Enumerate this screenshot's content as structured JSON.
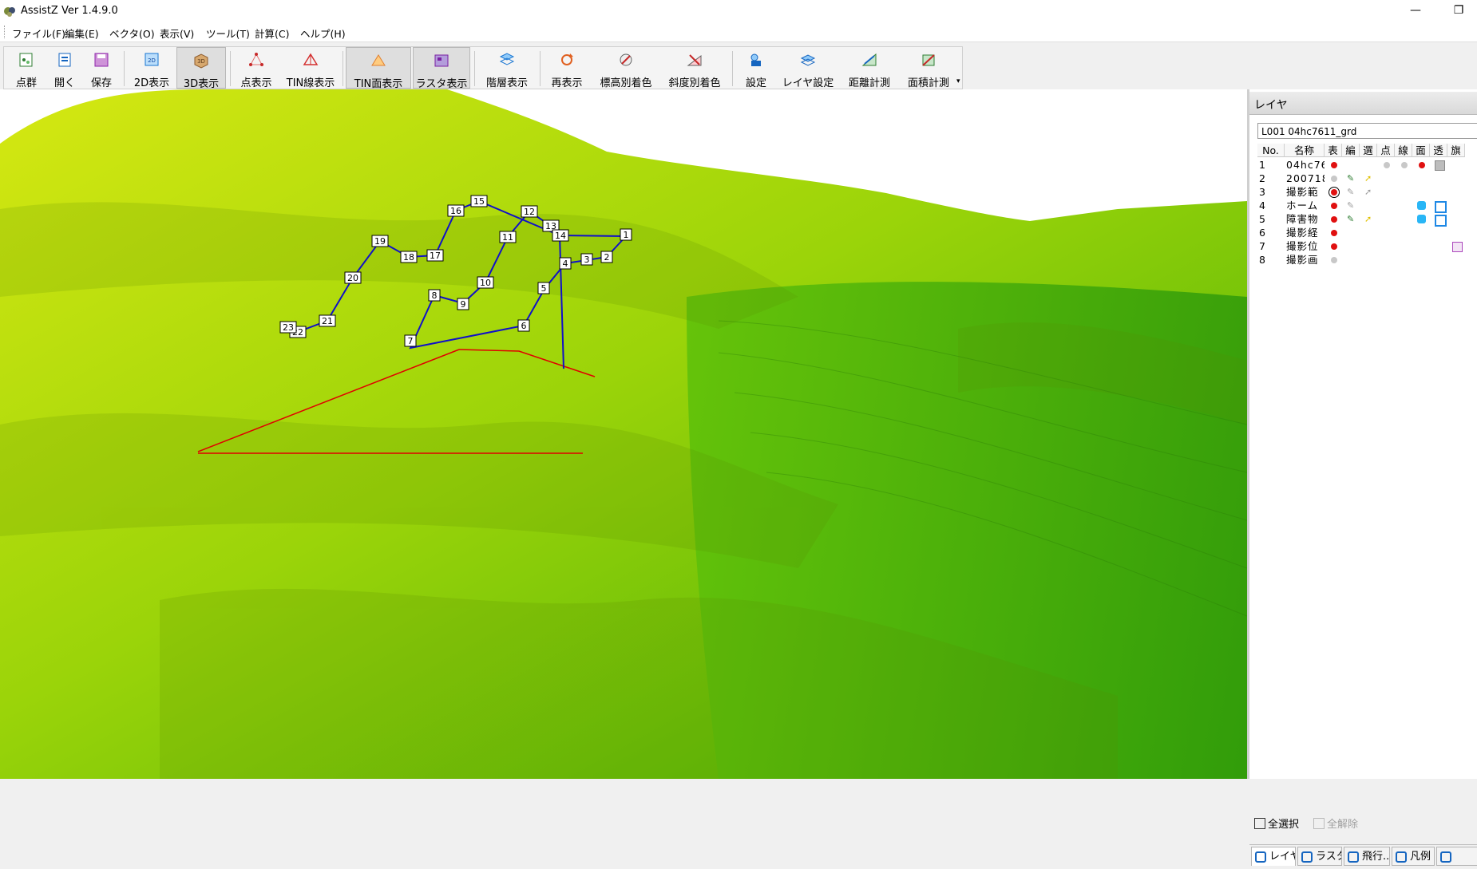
{
  "window": {
    "title": "AssistZ  Ver 1.4.9.0",
    "minimize": "—",
    "restore": "❐"
  },
  "menu": [
    "ファイル(F)",
    "編集(E)",
    "ベクタ(O)",
    "表示(V)",
    "ツール(T)",
    "計算(C)",
    "ヘルプ(H)"
  ],
  "toolbar": [
    {
      "label": "点群",
      "icon": "point-cloud-icon",
      "color": "#2e7d32",
      "active": false
    },
    {
      "label": "開く",
      "icon": "open-icon",
      "color": "#1565c0",
      "active": false
    },
    {
      "label": "保存",
      "icon": "save-icon",
      "color": "#8e24aa",
      "active": false
    },
    {
      "label": "2D表示",
      "icon": "2d-view-icon",
      "color": "#1976d2",
      "active": false
    },
    {
      "label": "3D表示",
      "icon": "3d-view-icon",
      "color": "#c08040",
      "active": true
    },
    {
      "label": "点表示",
      "icon": "point-display-icon",
      "color": "#c62828",
      "active": false
    },
    {
      "label": "TIN線表示",
      "icon": "tin-line-icon",
      "color": "#d32f2f",
      "active": false
    },
    {
      "label": "TIN面表示",
      "icon": "tin-surface-icon",
      "color": "#e08030",
      "active": true
    },
    {
      "label": "ラスタ表示",
      "icon": "raster-display-icon",
      "color": "#7b1fa2",
      "active": true
    },
    {
      "label": "階層表示",
      "icon": "hierarchy-icon",
      "color": "#1976d2",
      "active": false
    },
    {
      "label": "再表示",
      "icon": "refresh-icon",
      "color": "#e06020",
      "active": false
    },
    {
      "label": "標高別着色",
      "icon": "elevation-color-icon",
      "color": "#c62828",
      "active": false
    },
    {
      "label": "斜度別着色",
      "icon": "slope-color-icon",
      "color": "#c62828",
      "active": false
    },
    {
      "label": "設定",
      "icon": "settings-icon",
      "color": "#1565c0",
      "active": false
    },
    {
      "label": "レイヤ設定",
      "icon": "layer-settings-icon",
      "color": "#1565c0",
      "active": false
    },
    {
      "label": "距離計測",
      "icon": "distance-measure-icon",
      "color": "#2e7d32",
      "active": false
    },
    {
      "label": "面積計測",
      "icon": "area-measure-icon",
      "color": "#2e7d32",
      "active": false
    }
  ],
  "toolbar_more": "▾",
  "route": {
    "color": "#1010c8",
    "waypoints": [
      "1",
      "2",
      "3",
      "4",
      "5",
      "6",
      "7",
      "8",
      "9",
      "10",
      "11",
      "12",
      "13",
      "14",
      "15",
      "16",
      "17",
      "18",
      "19",
      "20",
      "21",
      "22",
      "23"
    ]
  },
  "measure_color": "#e00000",
  "panel": {
    "title": "レイヤ",
    "current_layer": "L001 04hc7611_grd",
    "columns": [
      "No.",
      "名称",
      "表",
      "編",
      "選",
      "点",
      "線",
      "面",
      "透",
      "旗"
    ],
    "layers": [
      {
        "no": "1",
        "name": "04hc76"
      },
      {
        "no": "2",
        "name": "200718"
      },
      {
        "no": "3",
        "name": "撮影範"
      },
      {
        "no": "4",
        "name": "ホーム"
      },
      {
        "no": "5",
        "name": "障害物"
      },
      {
        "no": "6",
        "name": "撮影経"
      },
      {
        "no": "7",
        "name": "撮影位"
      },
      {
        "no": "8",
        "name": "撮影画"
      }
    ],
    "select_all": "全選択",
    "deselect_all": "全解除",
    "tabs": [
      "レイヤ",
      "ラスタ",
      "飛行...",
      "凡例",
      ""
    ]
  }
}
